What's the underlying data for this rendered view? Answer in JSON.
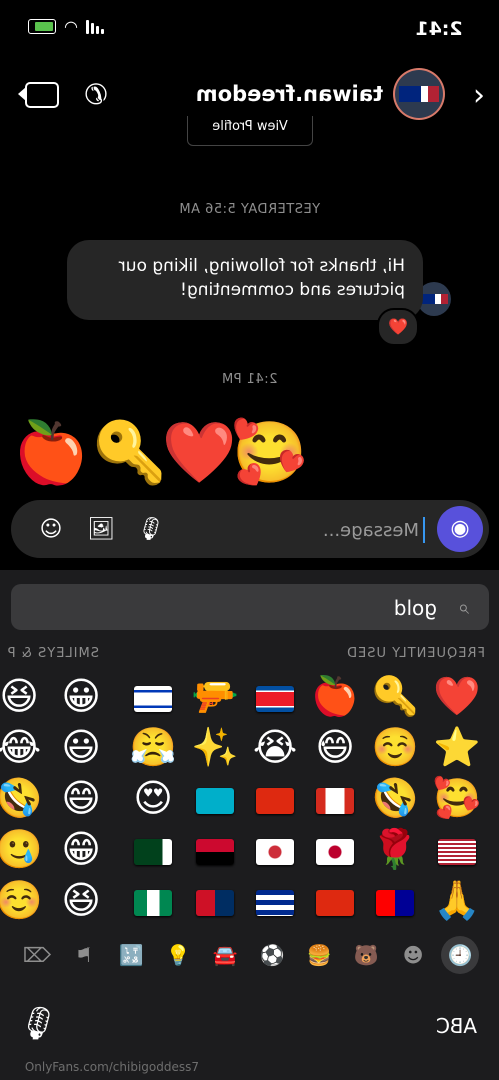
{
  "status": {
    "time": "2:41"
  },
  "header": {
    "username": "taiwan.freedom",
    "back_label": "‹",
    "view_profile": "View Profile"
  },
  "chat": {
    "timestamp_1": "YESTERDAY 5:56 AM",
    "message": "Hi, thanks for following, liking our pictures and commenting!",
    "reaction": "❤️",
    "timestamp_2": "2:41 PM",
    "sent_emojis": [
      "🍎",
      "🔑",
      "❤️",
      "🥰"
    ]
  },
  "composer": {
    "placeholder": "Message..."
  },
  "keyboard": {
    "search_text": "gold",
    "category_frequent": "FREQUENTLY USED",
    "category_smileys": "SMILEYS & P",
    "abc_label": "ABC",
    "grid": [
      [
        "❤️",
        "🔑",
        "🍎",
        "flag:kp",
        "🔫",
        "flag:il",
        "😀",
        "😆"
      ],
      [
        "⭐",
        "☺️",
        "😅",
        "😭",
        "✨",
        "😤",
        "😃",
        "😂"
      ],
      [
        "🥰",
        "🤣",
        "flag:ca",
        "flag:hk",
        "flag:kz",
        "😍",
        "😄",
        "🤣"
      ],
      [
        "flag:us",
        "🌹",
        "flag:jp",
        "flag:kr",
        "flag:ao",
        "flag:pk",
        "😁",
        "🥲"
      ],
      [
        "🙏",
        "flag:tw",
        "flag:cn",
        "flag:cu",
        "flag:do",
        "flag:ng",
        "😆",
        "☺️"
      ]
    ],
    "tabs": [
      "🕒",
      "☻",
      "🐻",
      "🍔",
      "⚽",
      "🚘",
      "💡",
      "🔣",
      "⚑",
      "⌫"
    ]
  },
  "watermark": "OnlyFans.com/chibigoddess7",
  "colors": {
    "accent": "#5851db",
    "bubble": "#262626",
    "keyboard": "#1c1c1e"
  }
}
